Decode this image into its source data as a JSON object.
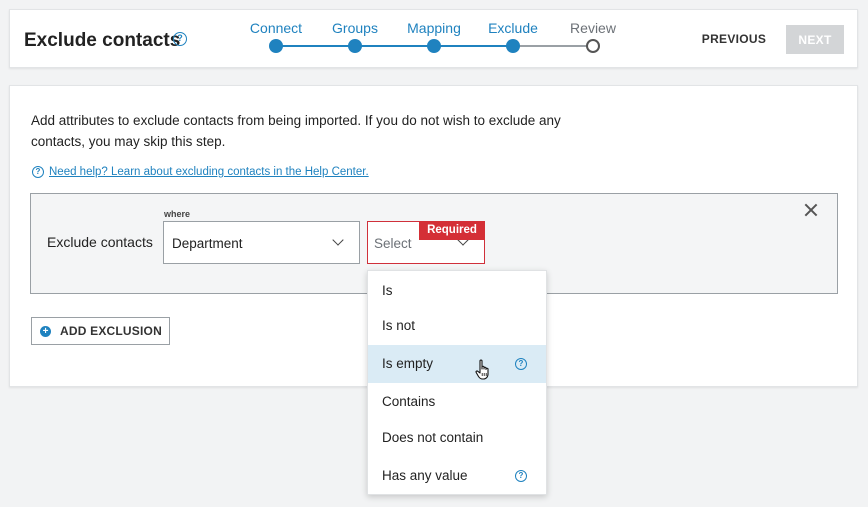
{
  "header": {
    "title": "Exclude contacts",
    "help_icon": "question-circle-icon",
    "steps": [
      {
        "label": "Connect",
        "state": "complete"
      },
      {
        "label": "Groups",
        "state": "complete"
      },
      {
        "label": "Mapping",
        "state": "complete"
      },
      {
        "label": "Exclude",
        "state": "current"
      },
      {
        "label": "Review",
        "state": "upcoming"
      }
    ],
    "previous_label": "PREVIOUS",
    "next_label": "NEXT"
  },
  "main": {
    "intro_text": "Add attributes to exclude contacts from being imported. If you do not wish to exclude any contacts, you may skip this step.",
    "help_link": "Need help? Learn about excluding contacts in the Help Center.",
    "exclusion": {
      "row_label": "Exclude contacts",
      "where_label": "where",
      "attribute_value": "Department",
      "operator_placeholder": "Select",
      "required_badge": "Required"
    },
    "add_exclusion_label": "ADD EXCLUSION"
  },
  "operator_dropdown": {
    "hovered_index": 2,
    "options": [
      {
        "label": "Is",
        "has_help": false
      },
      {
        "label": "Is not",
        "has_help": false
      },
      {
        "label": "Is empty",
        "has_help": true
      },
      {
        "label": "Contains",
        "has_help": false
      },
      {
        "label": "Does not contain",
        "has_help": false
      },
      {
        "label": "Has any value",
        "has_help": true
      }
    ]
  },
  "colors": {
    "accent": "#1f82bf",
    "required": "#d42f36",
    "disabled_button": "#d3d5d7",
    "hover_row": "#daebf5"
  }
}
